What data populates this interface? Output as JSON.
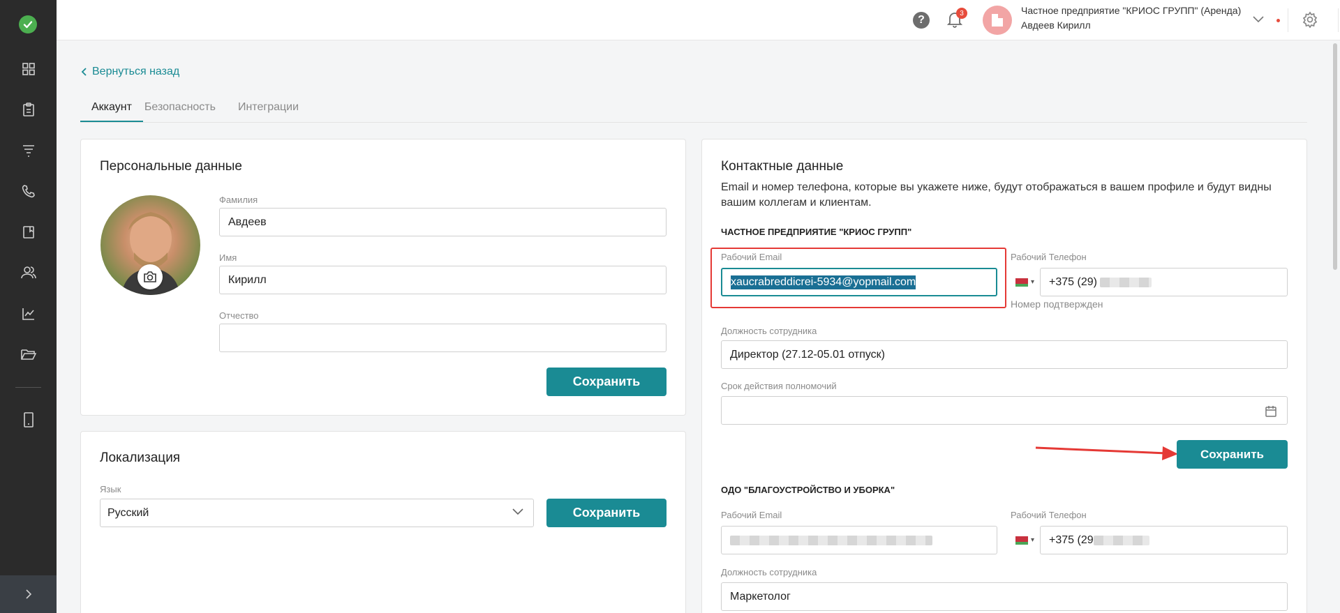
{
  "header": {
    "help": "?",
    "notifications_count": "3",
    "org_name": "Частное предприятие \"КРИОС ГРУПП\" (Аренда)",
    "user_name": "Авдеев Кирилл"
  },
  "sidebar": {
    "items": [
      "dashboard-icon",
      "clipboard-icon",
      "funnel-icon",
      "phone-icon",
      "book-icon",
      "users-icon",
      "chart-icon",
      "folder-icon",
      "tablet-icon"
    ],
    "expand": "›"
  },
  "nav": {
    "back": "Вернуться назад",
    "tabs": [
      "Аккаунт",
      "Безопасность",
      "Интеграции"
    ]
  },
  "personal": {
    "title": "Персональные данные",
    "lastname_label": "Фамилия",
    "lastname": "Авдеев",
    "firstname_label": "Имя",
    "firstname": "Кирилл",
    "patronymic_label": "Отчество",
    "patronymic": "",
    "save": "Сохранить"
  },
  "localization": {
    "title": "Локализация",
    "language_label": "Язык",
    "language": "Русский",
    "save": "Сохранить"
  },
  "contacts": {
    "title": "Контактные данные",
    "description": "Email и номер телефона, которые вы укажете ниже, будут отображаться в вашем профиле и будут видны вашим коллегам и клиентам.",
    "companies": [
      {
        "name": "ЧАСТНОЕ ПРЕДПРИЯТИЕ \"КРИОС ГРУПП\"",
        "email_label": "Рабочий Email",
        "email": "xaucrabreddicrei-5934@yopmail.com",
        "phone_label": "Рабочий Телефон",
        "phone": "+375 (29)",
        "phone_note": "Номер подтвержден",
        "position_label": "Должность сотрудника",
        "position": "Директор (27.12-05.01 отпуск)",
        "term_label": "Срок действия полномочий",
        "term": "",
        "save": "Сохранить"
      },
      {
        "name": "ОДО \"БЛАГОУСТРОЙСТВО И УБОРКА\"",
        "email_label": "Рабочий Email",
        "phone_label": "Рабочий Телефон",
        "phone": "+375 (29",
        "position_label": "Должность сотрудника",
        "position": "Маркетолог"
      }
    ]
  },
  "colors": {
    "accent": "#1a8b94",
    "sidebar": "#2b2b2b",
    "annotation": "#e53935"
  }
}
